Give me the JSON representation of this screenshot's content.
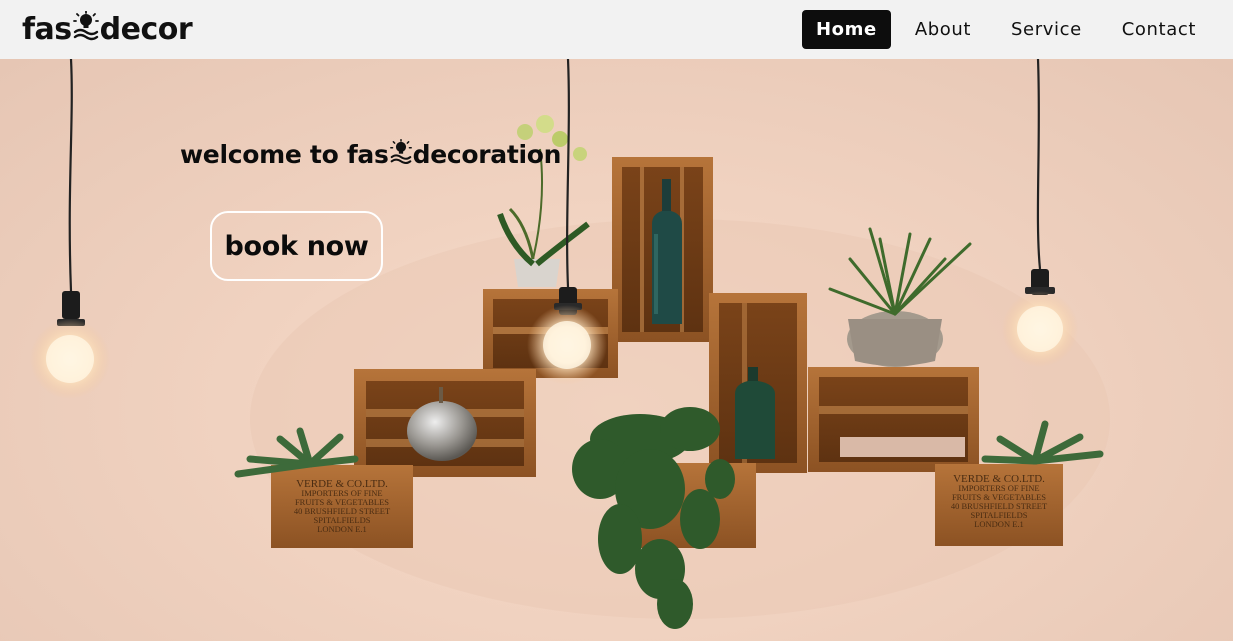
{
  "header": {
    "logo_left": "fas",
    "logo_right": "decor",
    "nav": [
      {
        "label": "Home",
        "active": true
      },
      {
        "label": "About",
        "active": false
      },
      {
        "label": "Service",
        "active": false
      },
      {
        "label": "Contact",
        "active": false
      }
    ]
  },
  "hero": {
    "title_left": "welcome to fas",
    "title_right": "decoration",
    "cta_label": "book now"
  },
  "crate_labels": {
    "left": [
      "VERDE & CO.LTD.",
      "IMPORTERS OF FINE",
      "FRUITS & VEGETABLES",
      "40 BRUSHFIELD STREET",
      "SPITALFIELDS",
      "LONDON E.1"
    ],
    "right": [
      "VERDE & CO.LTD.",
      "IMPORTERS OF FINE",
      "FRUITS & VEGETABLES",
      "40 BRUSHFIELD STREET",
      "SPITALFIELDS",
      "LONDON E.1"
    ]
  },
  "colors": {
    "nav_active_bg": "#0d0d0d",
    "header_bg": "#f2f2f2",
    "wall": "#f1d3c1",
    "wood": "#a0622b"
  }
}
